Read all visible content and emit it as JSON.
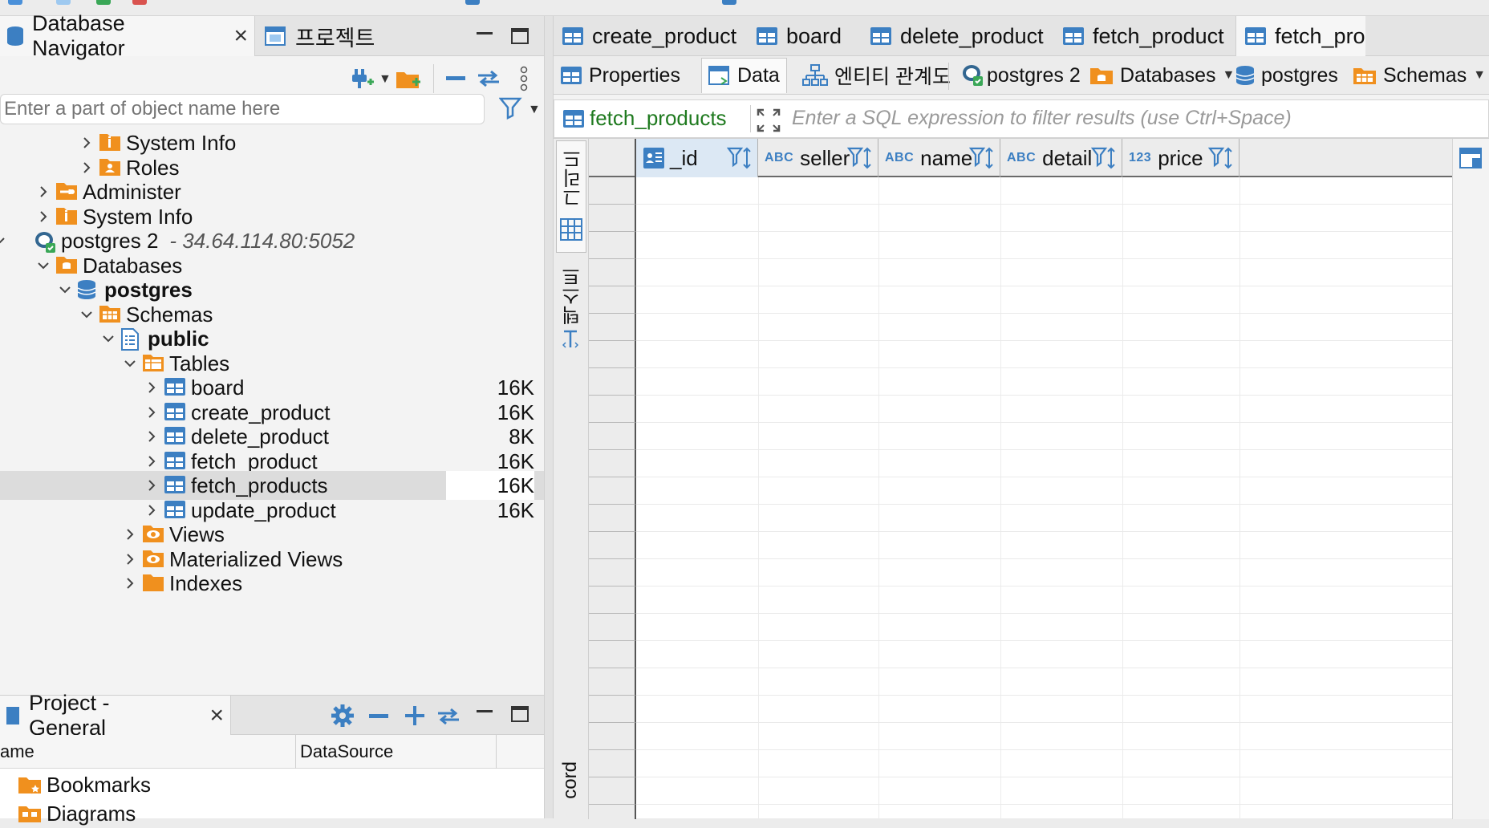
{
  "navigator": {
    "tab_label": "Database Navigator",
    "projects_tab_label": "프로젝트",
    "search_placeholder": "Enter a part of object name here",
    "tree": [
      {
        "label": "System Info",
        "icon": "info-folder-icon",
        "depth": 3,
        "expanded": false
      },
      {
        "label": "Roles",
        "icon": "roles-folder-icon",
        "depth": 3,
        "expanded": false
      },
      {
        "label": "Administer",
        "icon": "administer-folder-icon",
        "depth": 1,
        "expanded": false
      },
      {
        "label": "System Info",
        "icon": "info-folder-icon",
        "depth": 1,
        "expanded": false
      },
      {
        "label": "postgres 2",
        "host": "- 34.64.114.80:5052",
        "icon": "postgres-connection-icon",
        "depth": 0,
        "expanded": true
      },
      {
        "label": "Databases",
        "icon": "databases-folder-icon",
        "depth": 1,
        "expanded": true
      },
      {
        "label": "postgres",
        "icon": "database-icon",
        "depth": 2,
        "expanded": true,
        "bold": true
      },
      {
        "label": "Schemas",
        "icon": "schemas-folder-icon",
        "depth": 3,
        "expanded": true
      },
      {
        "label": "public",
        "icon": "schema-icon",
        "depth": 4,
        "expanded": true,
        "bold": true
      },
      {
        "label": "Tables",
        "icon": "tables-folder-icon",
        "depth": 5,
        "expanded": true
      },
      {
        "label": "board",
        "icon": "table-icon",
        "depth": 6,
        "size": "16K"
      },
      {
        "label": "create_product",
        "icon": "table-icon",
        "depth": 6,
        "size": "16K"
      },
      {
        "label": "delete_product",
        "icon": "table-icon",
        "depth": 6,
        "size": "8K"
      },
      {
        "label": "fetch_product",
        "icon": "table-icon",
        "depth": 6,
        "size": "16K"
      },
      {
        "label": "fetch_products",
        "icon": "table-icon",
        "depth": 6,
        "size": "16K",
        "selected": true
      },
      {
        "label": "update_product",
        "icon": "table-icon",
        "depth": 6,
        "size": "16K"
      },
      {
        "label": "Views",
        "icon": "views-folder-icon",
        "depth": 5
      },
      {
        "label": "Materialized Views",
        "icon": "views-folder-icon",
        "depth": 5
      },
      {
        "label": "Indexes",
        "icon": "indexes-folder-icon",
        "depth": 5
      }
    ]
  },
  "project": {
    "tab_label": "Project - General",
    "columns": [
      "ame",
      "DataSource"
    ],
    "items": [
      {
        "label": "Bookmarks",
        "icon": "bookmarks-folder-icon"
      },
      {
        "label": "Diagrams",
        "icon": "diagrams-folder-icon"
      }
    ]
  },
  "editor": {
    "tabs": [
      "create_product",
      "board",
      "delete_product",
      "fetch_product",
      "fetch_pro"
    ],
    "subtabs": {
      "properties": "Properties",
      "data": "Data",
      "er": "엔티티 관계도",
      "connection": "postgres 2",
      "databases": "Databases",
      "database": "postgres",
      "schemas": "Schemas"
    },
    "filter": {
      "table": "fetch_products",
      "placeholder": "Enter a SQL expression to filter results (use Ctrl+Space)"
    },
    "side": {
      "grid": "그리드",
      "text": "텍스트",
      "record": "cord"
    },
    "columns": [
      {
        "name": "_id",
        "type": ""
      },
      {
        "name": "seller",
        "type": "ABC"
      },
      {
        "name": "name",
        "type": "ABC"
      },
      {
        "name": "detail",
        "type": "ABC"
      },
      {
        "name": "price",
        "type": "123"
      }
    ]
  },
  "colors": {
    "accent": "#3c7fc2",
    "folder": "#f0901e",
    "selection": "#dcdcdc"
  }
}
